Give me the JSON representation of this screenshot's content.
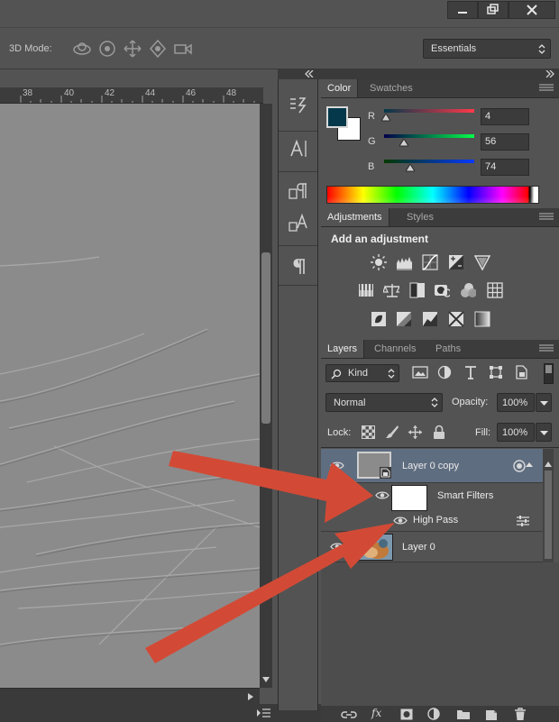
{
  "options_bar": {
    "mode_label": "3D Mode:",
    "tools": [
      "rotate-3d-icon",
      "roll-3d-icon",
      "drag-3d-icon",
      "slide-3d-icon",
      "scale-3d-icon"
    ],
    "workspace_value": "Essentials"
  },
  "window_controls": [
    "minimize-icon",
    "restore-icon",
    "close-icon"
  ],
  "ruler": {
    "ticks": [
      "38",
      "40",
      "42",
      "44",
      "46",
      "48"
    ]
  },
  "color_panel": {
    "tabs": [
      "Color",
      "Swatches"
    ],
    "channels": [
      {
        "label": "R",
        "value": "4"
      },
      {
        "label": "G",
        "value": "56"
      },
      {
        "label": "B",
        "value": "74"
      }
    ],
    "slider_positions": [
      0.016,
      0.22,
      0.29
    ],
    "foreground": "#04384a",
    "background": "#ffffff"
  },
  "adjustments_panel": {
    "tabs": [
      "Adjustments",
      "Styles"
    ],
    "title": "Add an adjustment",
    "icons": [
      [
        "brightness-contrast-icon",
        "levels-icon",
        "curves-icon",
        "exposure-icon",
        "vibrance-icon"
      ],
      [
        "hue-saturation-icon",
        "color-balance-icon",
        "black-white-icon",
        "photo-filter-icon",
        "channel-mixer-icon",
        "color-lookup-icon"
      ],
      [
        "invert-icon",
        "posterize-icon",
        "threshold-icon",
        "selective-color-icon",
        "gradient-map-icon"
      ]
    ]
  },
  "layers_panel": {
    "tabs": [
      "Layers",
      "Channels",
      "Paths"
    ],
    "filter_kind": "Kind",
    "blend_mode": "Normal",
    "opacity_label": "Opacity:",
    "opacity_value": "100%",
    "lock_label": "Lock:",
    "fill_label": "Fill:",
    "fill_value": "100%",
    "rows": {
      "layer_copy": "Layer 0 copy",
      "smart_filters": "Smart Filters",
      "high_pass": "High Pass",
      "layer_0": "Layer 0"
    }
  },
  "colors": {
    "arrow": "#d24a36",
    "selected_row": "#5f6d80",
    "panel_bg": "#535353"
  }
}
